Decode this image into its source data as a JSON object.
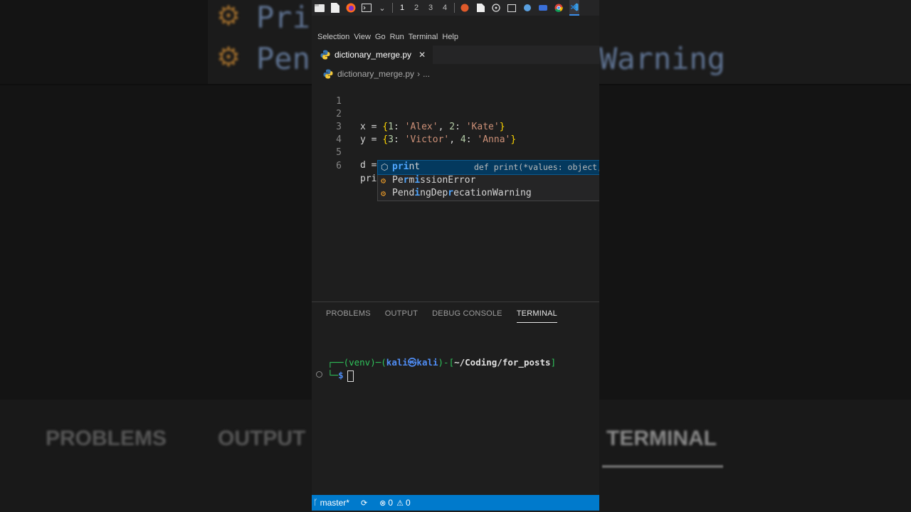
{
  "background": {
    "word1": "Pri",
    "word2": "Pen",
    "word3": "Warning",
    "tabs": [
      "PROBLEMS",
      "OUTPUT",
      "TERMINAL"
    ]
  },
  "taskbar": {
    "workspaces": [
      "1",
      "2",
      "3",
      "4"
    ],
    "active_workspace": "1"
  },
  "menubar": [
    "Selection",
    "View",
    "Go",
    "Run",
    "Terminal",
    "Help"
  ],
  "tab": {
    "filename": "dictionary_merge.py",
    "close": "✕"
  },
  "breadcrumb": {
    "file": "dictionary_merge.py",
    "separator": "›",
    "more": "..."
  },
  "editor": {
    "line_numbers": [
      "1",
      "2",
      "3",
      "4",
      "5",
      "6"
    ],
    "line2": {
      "var": "x",
      "op": " = ",
      "k1": "1",
      "v1": "'Alex'",
      "k2": "2",
      "v2": "'Kate'"
    },
    "line3": {
      "var": "y",
      "op": " = ",
      "k1": "3",
      "v1": "'Victor'",
      "k2": "4",
      "v2": "'Anna'"
    },
    "line5": "d = x | y",
    "line6": "pri"
  },
  "suggestions": [
    {
      "pre": "",
      "hl": "pri",
      "post": "nt",
      "detail": "def print(*values: object,",
      "kind": "keyword"
    },
    {
      "pre": "Pe",
      "hl": "r",
      "mid": "m",
      "hl2": "i",
      "post": "ssionError",
      "kind": "class"
    },
    {
      "pre": "Pend",
      "hl": "i",
      "mid": "ngDep",
      "hl2": "r",
      "post": "ecationWarning",
      "kind": "class"
    }
  ],
  "panel_tabs": [
    "PROBLEMS",
    "OUTPUT",
    "DEBUG CONSOLE",
    "TERMINAL"
  ],
  "active_panel_tab": "TERMINAL",
  "terminal": {
    "line1_prefix": "┌──(venv)─(",
    "user": "kali",
    "at": "㉿",
    "host": "kali",
    "mid": ")-[",
    "path": "~/Coding/for_posts",
    "end": "]",
    "line2_prefix": "└─",
    "prompt": "$"
  },
  "statusbar": {
    "branch": "master*",
    "errors": "0",
    "warnings": "0"
  },
  "colors": {
    "accent": "#007acc",
    "editor_bg": "#1e1e1e",
    "string": "#ce9178",
    "number": "#b5cea8",
    "bracket": "#ffd700"
  }
}
